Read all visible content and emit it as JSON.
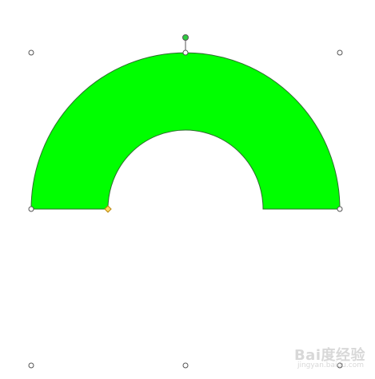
{
  "shape": {
    "type": "block-arc",
    "fill_color": "#00ff00",
    "stroke_color": "#2e6b2e",
    "handle_fill": "#ffffff",
    "handle_stroke": "#555555",
    "rotation_handle_fill": "#2ecc40",
    "adjust_handle_fill": "#ffd966"
  },
  "watermark": {
    "brand": "Bai度经验",
    "url": "jingyan.baidu.com"
  }
}
